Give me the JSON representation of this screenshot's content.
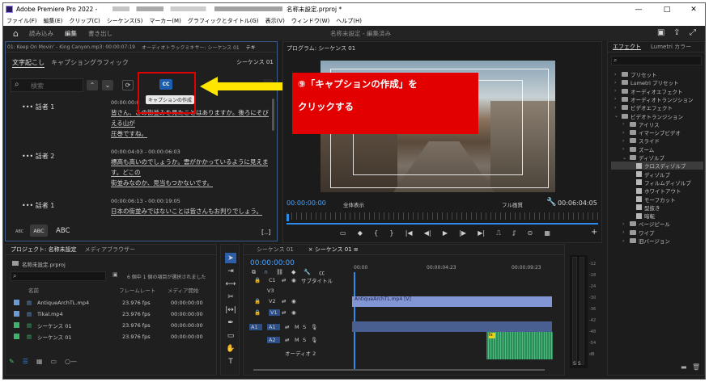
{
  "app": {
    "title": "Adobe Premiere Pro 2022 -",
    "project_file": "名称未設定.prproj *",
    "window_controls": [
      "—",
      "□",
      "✕"
    ]
  },
  "menu": [
    "ファイル(F)",
    "編集(E)",
    "クリップ(C)",
    "シーケンス(S)",
    "マーカー(M)",
    "グラフィックとタイトル(G)",
    "表示(V)",
    "ウィンドウ(W)",
    "ヘルプ(H)"
  ],
  "workspace": {
    "tabs": [
      "読み込み",
      "編集",
      "書き出し"
    ],
    "active_tab": "編集",
    "center_title": "名称未設定 - 編集済み"
  },
  "transcript_panel": {
    "header_tabs": [
      "01: Keep On Movin' - King Canyon.mp3: 00:00:07:19",
      "オーディオトラックミキサー: シーケンス 01",
      "テキ"
    ],
    "tabs": [
      "文字起こし",
      "キャプション",
      "グラフィック"
    ],
    "sequence": "シーケンス 01",
    "search_placeholder": "検索",
    "cc_button": "CC",
    "tooltip": "キャプションの作成",
    "entries": [
      {
        "speaker": "話者 1",
        "timecode": "00:00:00:0",
        "text": [
          "皆さん、この街並みを見たことはありますか。後ろにそびえる山が",
          "圧巻ですね。"
        ]
      },
      {
        "speaker": "話者 2",
        "timecode": "00:00:04:03 - 00:00:06:03",
        "text": [
          "標高も高いのでしょうか。雲がかかっているように見えます。どこの",
          "街並みなのか、見当もつかないです。"
        ]
      },
      {
        "speaker": "話者 1",
        "timecode": "00:00:06:13 - 00:00:19:05",
        "text": [
          "日本の街並みではないことは皆さんもお判りでしょう。"
        ]
      }
    ],
    "footer": {
      "abc_small": "ABC",
      "abc_mid": "ABC",
      "abc_large": "ABC",
      "bracket": "[..]"
    }
  },
  "annotation": {
    "line1": "⑨「キャプションの作成」を",
    "line2": "クリックする",
    "color": "#e20000",
    "arrow_color": "#ffe600"
  },
  "program_monitor": {
    "title": "プログラム: シーケンス 01",
    "timecode": "00:00:00:00",
    "fit": "全体表示",
    "quality": "フル画質",
    "duration": "00:06:04:05"
  },
  "effects_panel": {
    "tabs": [
      "エフェクト",
      "Lumetri カラー"
    ],
    "items": [
      {
        "label": "プリセット",
        "kind": "folder"
      },
      {
        "label": "Lumetri プリセット",
        "kind": "folder"
      },
      {
        "label": "オーディオエフェクト",
        "kind": "folder"
      },
      {
        "label": "オーディオトランジション",
        "kind": "folder"
      },
      {
        "label": "ビデオエフェクト",
        "kind": "folder"
      },
      {
        "label": "ビデオトランジション",
        "kind": "folder-open"
      },
      {
        "label": "アイリス",
        "kind": "sub"
      },
      {
        "label": "イマーシブビデオ",
        "kind": "sub"
      },
      {
        "label": "スライド",
        "kind": "sub"
      },
      {
        "label": "ズーム",
        "kind": "sub"
      },
      {
        "label": "ディゾルブ",
        "kind": "sub-open"
      },
      {
        "label": "クロスディゾルブ",
        "kind": "fx",
        "selected": true
      },
      {
        "label": "ディゾルブ",
        "kind": "fx"
      },
      {
        "label": "フィルムディゾルブ",
        "kind": "fx"
      },
      {
        "label": "ホワイトアウト",
        "kind": "fx"
      },
      {
        "label": "モーフカット",
        "kind": "fx"
      },
      {
        "label": "型抜き",
        "kind": "fx"
      },
      {
        "label": "暗転",
        "kind": "fx"
      },
      {
        "label": "ページピール",
        "kind": "sub"
      },
      {
        "label": "ワイプ",
        "kind": "sub"
      },
      {
        "label": "旧バージョン",
        "kind": "sub"
      }
    ]
  },
  "project_panel": {
    "tabs": [
      "プロジェクト: 名称未設定",
      "メディアブラウザー"
    ],
    "file": "名称未設定.prproj",
    "selection_info": "6 個中 1 個の項目が選択されました",
    "columns": [
      "名前",
      "フレームレート",
      "メディア開始"
    ],
    "rows": [
      {
        "name": "AntiqueArchTL.mp4",
        "fps": "23.976 fps",
        "start": "00:00:00:00",
        "color": "#6a9bd8"
      },
      {
        "name": "Tikal.mp4",
        "fps": "23.976 fps",
        "start": "00:00:00:00",
        "color": "#6a9bd8"
      },
      {
        "name": "シーケンス 01",
        "fps": "23.976 fps",
        "start": "00:00:00:00",
        "color": "#3fb36b"
      },
      {
        "name": "シーケンス 01",
        "fps": "23.976 fps",
        "start": "00:00:00:00",
        "color": "#3fb36b"
      }
    ]
  },
  "timeline": {
    "tabs": [
      "シーケンス 01",
      "シーケンス 01"
    ],
    "timecode": "00:00:00:00",
    "ruler": [
      "00:00",
      "00:00:04:23",
      "00:00:09:23"
    ],
    "subtitle_track": "サブタイトル",
    "tracks": [
      "C1",
      "V3",
      "V2",
      "V1",
      "A1",
      "A2"
    ],
    "clip_label": "AntiqueArchTL.mp4 [V]",
    "audio_track_label": "オーディオ 2",
    "meter_db": [
      "-12",
      "-18",
      "-24",
      "-30",
      "-36",
      "-42",
      "-48",
      "-54",
      "dB"
    ],
    "meter_solo": "S S"
  },
  "colors": {
    "clip_video": "#8296d6",
    "clip_audio": "#2f8a5a",
    "accent_blue": "#2d8ceb"
  }
}
